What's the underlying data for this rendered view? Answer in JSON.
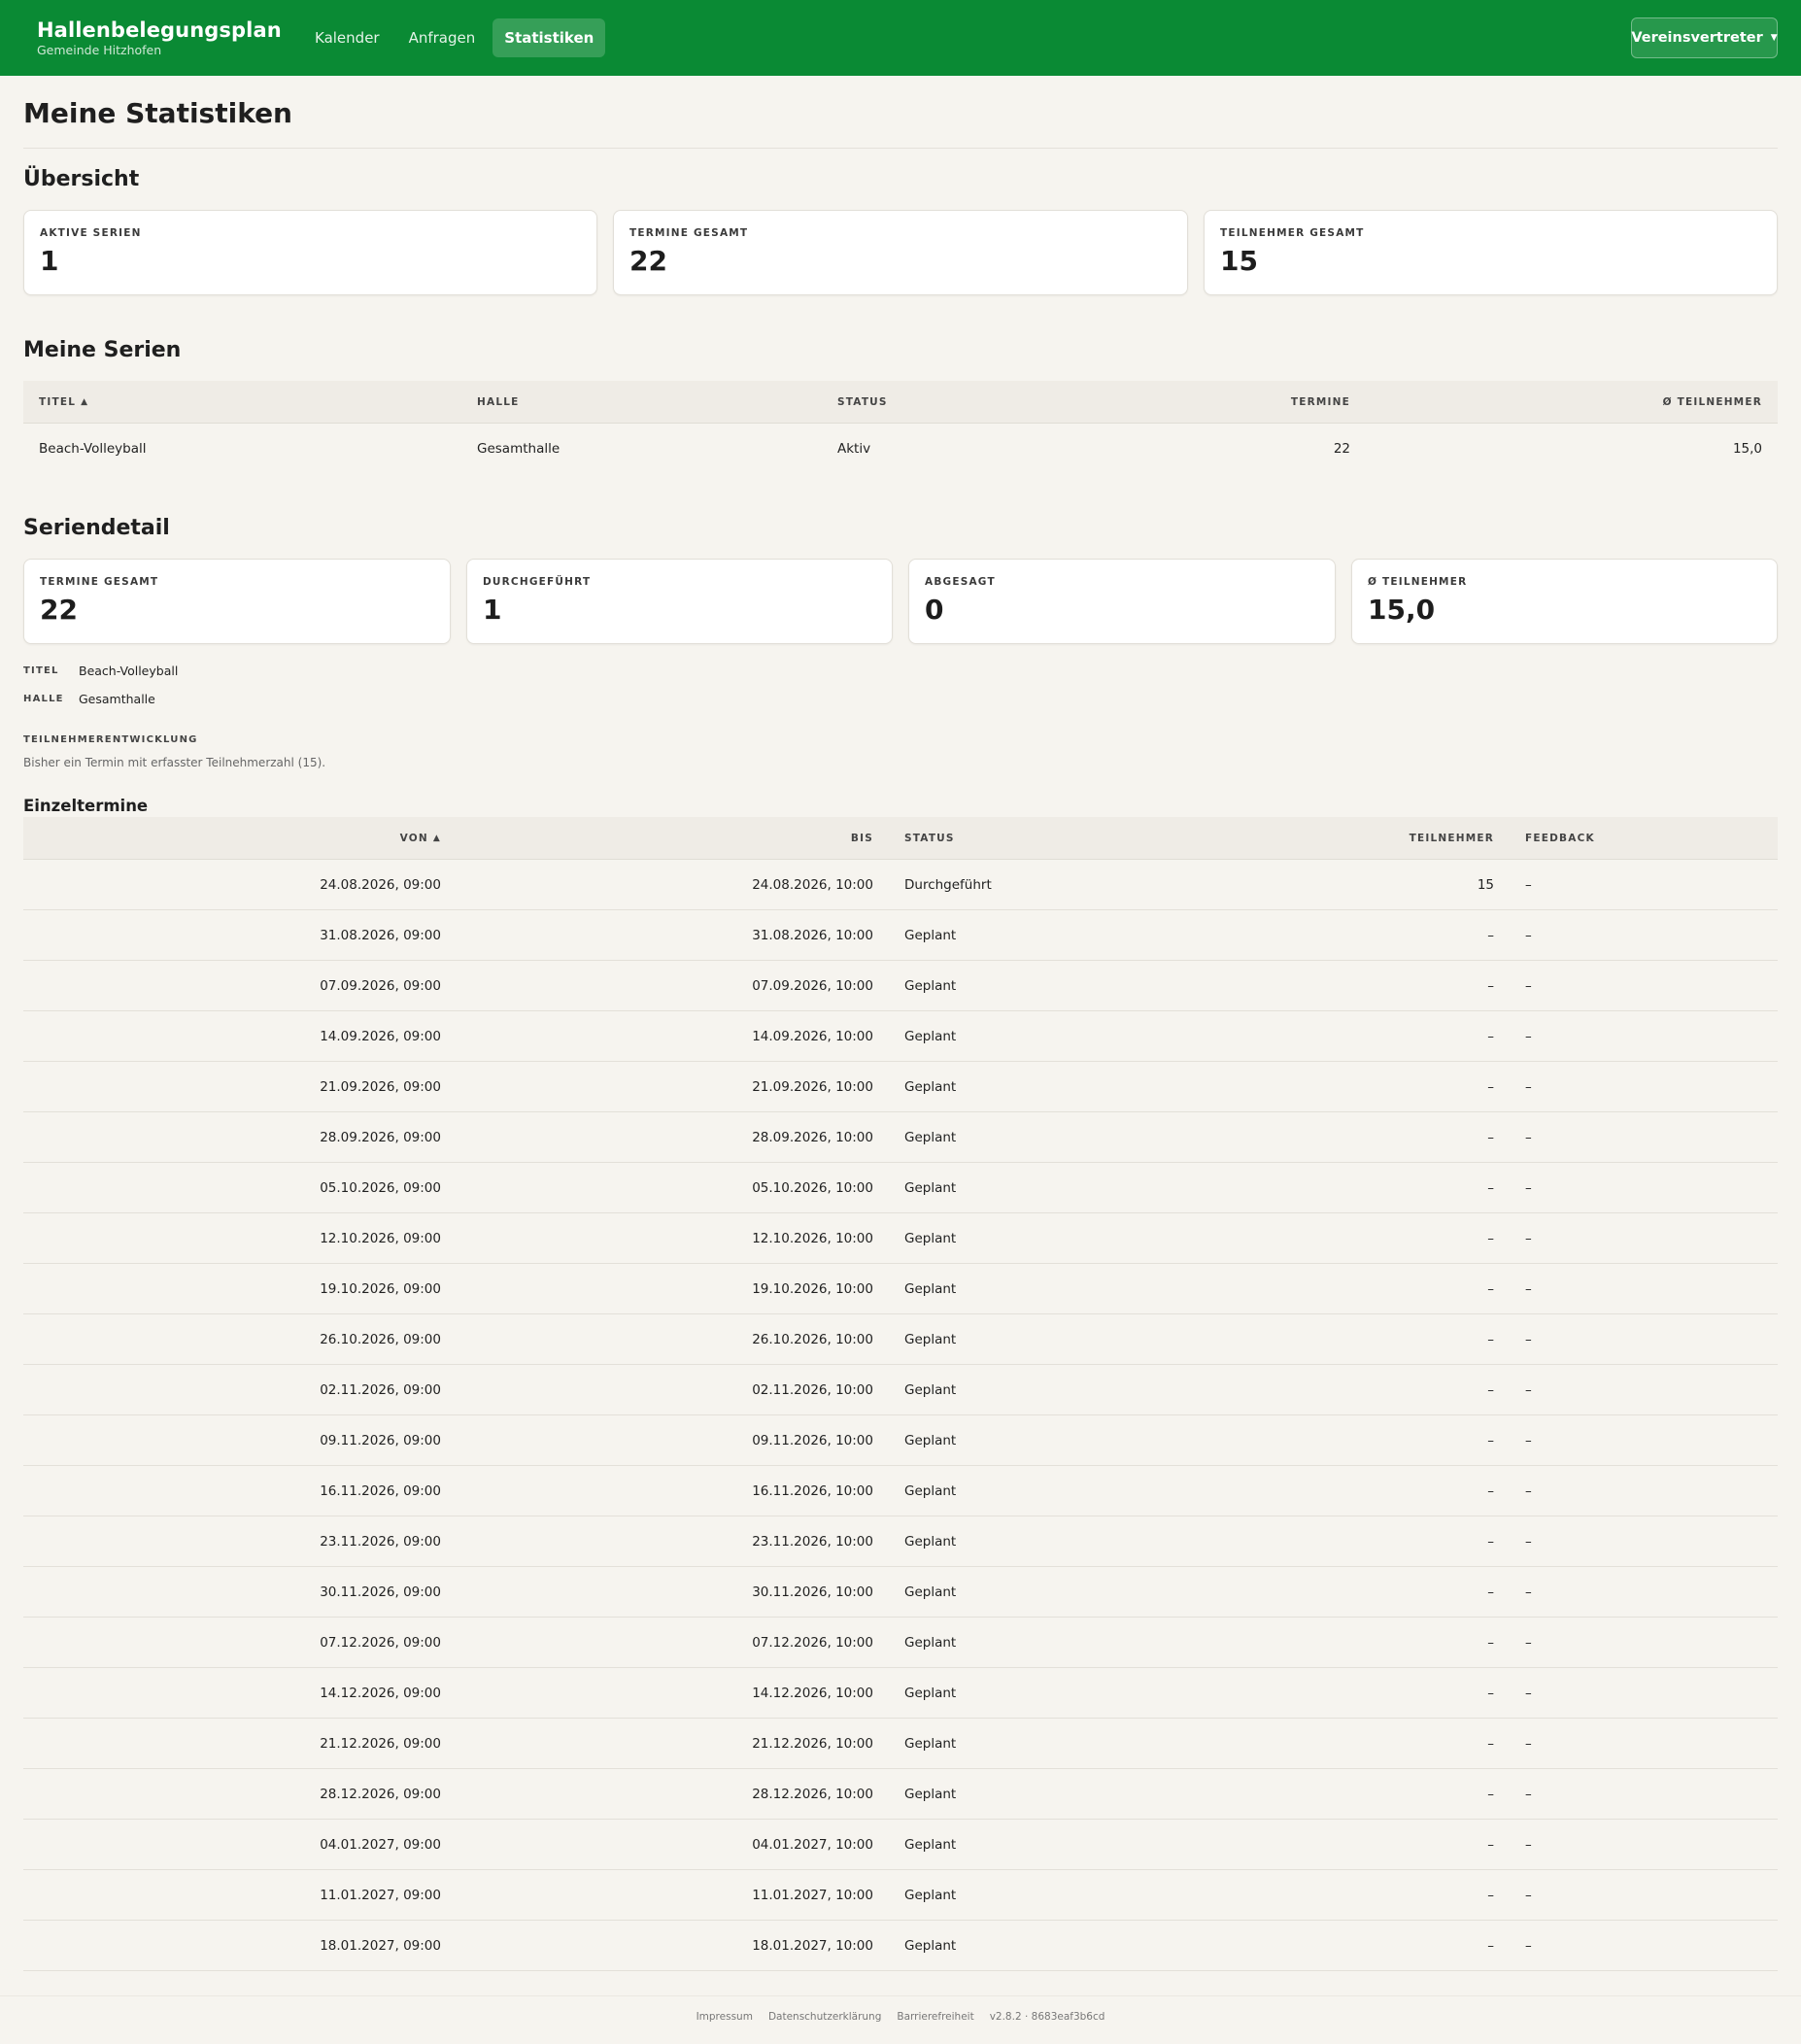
{
  "app": {
    "title": "Hallenbelegungsplan",
    "subtitle": "Gemeinde Hitzhofen",
    "brand_color": "#0a8a34"
  },
  "nav": [
    {
      "label": "Kalender",
      "active": false
    },
    {
      "label": "Anfragen",
      "active": false
    },
    {
      "label": "Statistiken",
      "active": true
    }
  ],
  "user_menu": {
    "label": "Vereinsvertreter",
    "icon": "chevron-down-icon"
  },
  "page": {
    "title": "Meine Statistiken"
  },
  "overview": {
    "heading": "Übersicht",
    "cards": [
      {
        "label": "Aktive Serien",
        "value": "1"
      },
      {
        "label": "Termine gesamt",
        "value": "22"
      },
      {
        "label": "Teilnehmer gesamt",
        "value": "15"
      }
    ]
  },
  "series": {
    "heading": "Meine Serien",
    "columns": [
      "Titel",
      "Halle",
      "Status",
      "Termine",
      "Ø Teilnehmer"
    ],
    "rows": [
      {
        "titel": "Beach-Volleyball",
        "halle": "Gesamthalle",
        "status": "Aktiv",
        "termine": "22",
        "teilnehmer": "15,0"
      }
    ]
  },
  "detail": {
    "heading": "Seriendetail",
    "cards": [
      {
        "label": "Termine gesamt",
        "value": "22"
      },
      {
        "label": "Durchgeführt",
        "value": "1"
      },
      {
        "label": "Abgesagt",
        "value": "0"
      },
      {
        "label": "Ø Teilnehmer",
        "value": "15,0"
      }
    ],
    "meta": [
      {
        "label": "TITEL",
        "value": "Beach-Volleyball"
      },
      {
        "label": "HALLE",
        "value": "Gesamthalle"
      }
    ],
    "trend_title": "TEILNEHMERENTWICKLUNG",
    "trend_text": "Bisher ein Termin mit erfasster Teilnehmerzahl (15)."
  },
  "appointments": {
    "heading": "Einzeltermine",
    "columns": [
      "Von",
      "Bis",
      "Status",
      "Teilnehmer",
      "Feedback"
    ],
    "rows": [
      {
        "von": "24.08.2026, 09:00",
        "bis": "24.08.2026, 10:00",
        "status": "Durchgeführt",
        "teilnehmer": "15",
        "feedback": "–"
      },
      {
        "von": "31.08.2026, 09:00",
        "bis": "31.08.2026, 10:00",
        "status": "Geplant",
        "teilnehmer": "–",
        "feedback": "–"
      },
      {
        "von": "07.09.2026, 09:00",
        "bis": "07.09.2026, 10:00",
        "status": "Geplant",
        "teilnehmer": "–",
        "feedback": "–"
      },
      {
        "von": "14.09.2026, 09:00",
        "bis": "14.09.2026, 10:00",
        "status": "Geplant",
        "teilnehmer": "–",
        "feedback": "–"
      },
      {
        "von": "21.09.2026, 09:00",
        "bis": "21.09.2026, 10:00",
        "status": "Geplant",
        "teilnehmer": "–",
        "feedback": "–"
      },
      {
        "von": "28.09.2026, 09:00",
        "bis": "28.09.2026, 10:00",
        "status": "Geplant",
        "teilnehmer": "–",
        "feedback": "–"
      },
      {
        "von": "05.10.2026, 09:00",
        "bis": "05.10.2026, 10:00",
        "status": "Geplant",
        "teilnehmer": "–",
        "feedback": "–"
      },
      {
        "von": "12.10.2026, 09:00",
        "bis": "12.10.2026, 10:00",
        "status": "Geplant",
        "teilnehmer": "–",
        "feedback": "–"
      },
      {
        "von": "19.10.2026, 09:00",
        "bis": "19.10.2026, 10:00",
        "status": "Geplant",
        "teilnehmer": "–",
        "feedback": "–"
      },
      {
        "von": "26.10.2026, 09:00",
        "bis": "26.10.2026, 10:00",
        "status": "Geplant",
        "teilnehmer": "–",
        "feedback": "–"
      },
      {
        "von": "02.11.2026, 09:00",
        "bis": "02.11.2026, 10:00",
        "status": "Geplant",
        "teilnehmer": "–",
        "feedback": "–"
      },
      {
        "von": "09.11.2026, 09:00",
        "bis": "09.11.2026, 10:00",
        "status": "Geplant",
        "teilnehmer": "–",
        "feedback": "–"
      },
      {
        "von": "16.11.2026, 09:00",
        "bis": "16.11.2026, 10:00",
        "status": "Geplant",
        "teilnehmer": "–",
        "feedback": "–"
      },
      {
        "von": "23.11.2026, 09:00",
        "bis": "23.11.2026, 10:00",
        "status": "Geplant",
        "teilnehmer": "–",
        "feedback": "–"
      },
      {
        "von": "30.11.2026, 09:00",
        "bis": "30.11.2026, 10:00",
        "status": "Geplant",
        "teilnehmer": "–",
        "feedback": "–"
      },
      {
        "von": "07.12.2026, 09:00",
        "bis": "07.12.2026, 10:00",
        "status": "Geplant",
        "teilnehmer": "–",
        "feedback": "–"
      },
      {
        "von": "14.12.2026, 09:00",
        "bis": "14.12.2026, 10:00",
        "status": "Geplant",
        "teilnehmer": "–",
        "feedback": "–"
      },
      {
        "von": "21.12.2026, 09:00",
        "bis": "21.12.2026, 10:00",
        "status": "Geplant",
        "teilnehmer": "–",
        "feedback": "–"
      },
      {
        "von": "28.12.2026, 09:00",
        "bis": "28.12.2026, 10:00",
        "status": "Geplant",
        "teilnehmer": "–",
        "feedback": "–"
      },
      {
        "von": "04.01.2027, 09:00",
        "bis": "04.01.2027, 10:00",
        "status": "Geplant",
        "teilnehmer": "–",
        "feedback": "–"
      },
      {
        "von": "11.01.2027, 09:00",
        "bis": "11.01.2027, 10:00",
        "status": "Geplant",
        "teilnehmer": "–",
        "feedback": "–"
      },
      {
        "von": "18.01.2027, 09:00",
        "bis": "18.01.2027, 10:00",
        "status": "Geplant",
        "teilnehmer": "–",
        "feedback": "–"
      }
    ]
  },
  "footer": {
    "links": [
      "Impressum",
      "Datenschutzerklärung",
      "Barrierefreiheit"
    ],
    "version": "v2.8.2 · 8683eaf3b6cd"
  }
}
